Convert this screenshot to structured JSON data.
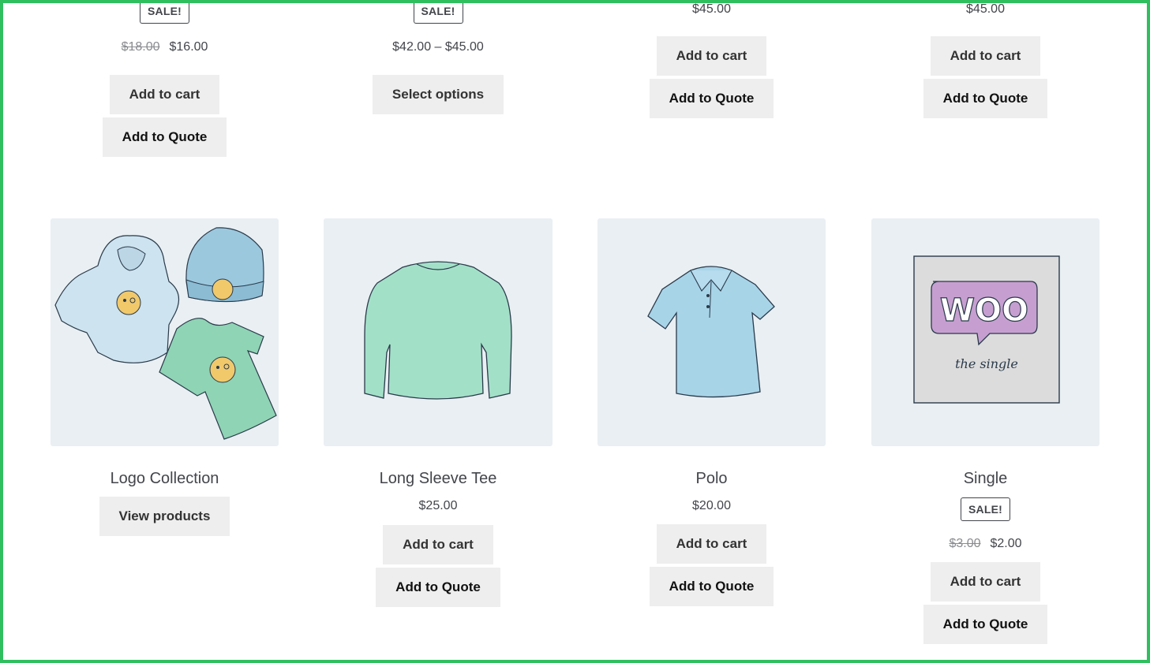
{
  "top_row": [
    {
      "badge": "SALE!",
      "price_old": "$18.00",
      "price_new": "$16.00",
      "buttons": [
        "Add to cart",
        "Add to Quote"
      ]
    },
    {
      "badge": "SALE!",
      "price_range": "$42.00 – $45.00",
      "buttons": [
        "Select options"
      ]
    },
    {
      "price": "$45.00",
      "buttons": [
        "Add to cart",
        "Add to Quote"
      ]
    },
    {
      "price": "$45.00",
      "buttons": [
        "Add to cart",
        "Add to Quote"
      ]
    }
  ],
  "products": [
    {
      "title": "Logo Collection",
      "image": "logo-collection-image",
      "buttons": [
        "View products"
      ]
    },
    {
      "title": "Long Sleeve Tee",
      "image": "long-sleeve-tee-image",
      "price": "$25.00",
      "buttons": [
        "Add to cart",
        "Add to Quote"
      ]
    },
    {
      "title": "Polo",
      "image": "polo-image",
      "price": "$20.00",
      "buttons": [
        "Add to cart",
        "Add to Quote"
      ]
    },
    {
      "title": "Single",
      "image": "woo-single-album-image",
      "badge": "SALE!",
      "price_old": "$3.00",
      "price_new": "$2.00",
      "buttons": [
        "Add to cart",
        "Add to Quote"
      ],
      "album_logo": "WOO",
      "album_caption": "the single"
    }
  ],
  "colors": {
    "frame_border": "#2fbf5f",
    "button_bg": "#eeeeee",
    "thumb_bg": "#e9eff3"
  }
}
